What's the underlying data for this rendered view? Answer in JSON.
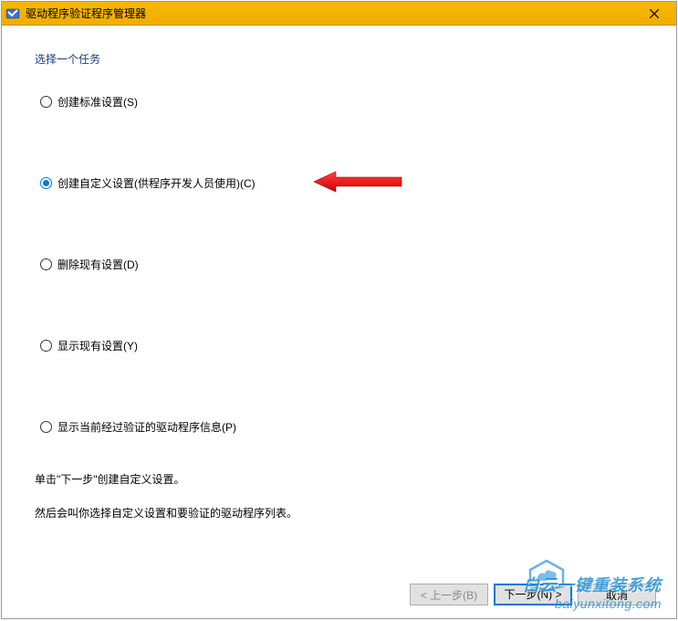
{
  "window": {
    "title": "驱动程序验证程序管理器",
    "close_label": "✕"
  },
  "task": {
    "group_label": "选择一个任务",
    "options": [
      {
        "label": "创建标准设置(S)",
        "selected": false
      },
      {
        "label": "创建自定义设置(供程序开发人员使用)(C)",
        "selected": true
      },
      {
        "label": "删除现有设置(D)",
        "selected": false
      },
      {
        "label": "显示现有设置(Y)",
        "selected": false
      },
      {
        "label": "显示当前经过验证的驱动程序信息(P)",
        "selected": false
      }
    ]
  },
  "instructions": {
    "line1": "单击\"下一步\"创建自定义设置。",
    "line2": "然后会叫你选择自定义设置和要验证的驱动程序列表。"
  },
  "buttons": {
    "back": "< 上一步(B)",
    "next": "下一步(N) >",
    "cancel": "取消"
  },
  "watermark": {
    "line1": "白云一键重装系统",
    "line2": "baiyunxitong.com"
  }
}
